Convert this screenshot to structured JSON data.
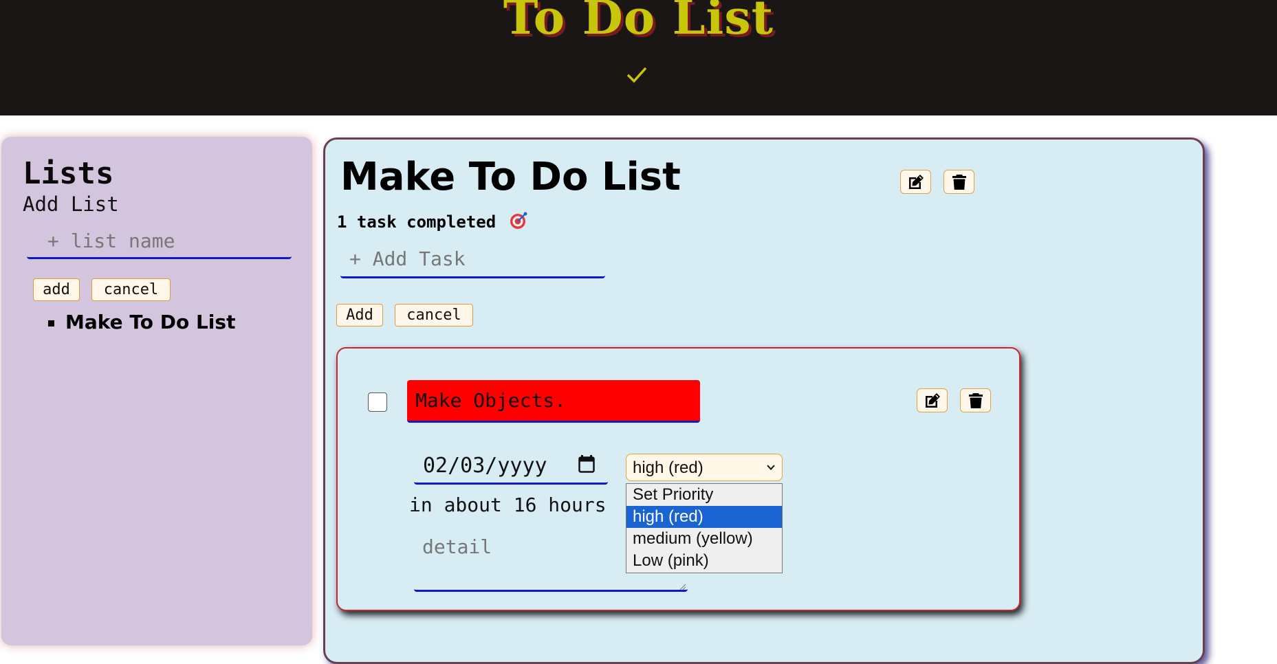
{
  "header": {
    "title": "To Do List",
    "check_icon": "check-icon"
  },
  "sidebar": {
    "title": "Lists",
    "add_list_label": "Add List",
    "list_name_placeholder": "+ list name",
    "add_label": "add",
    "cancel_label": "cancel",
    "lists": [
      {
        "name": "Make To Do List"
      }
    ]
  },
  "main": {
    "list_title": "Make To Do List",
    "edit_icon": "edit-icon",
    "delete_icon": "trash-icon",
    "tasks_completed": "1 task completed",
    "target_icon": "target-icon",
    "add_task_placeholder": "+ Add Task",
    "add_label": "Add",
    "cancel_label": "cancel",
    "task": {
      "name": "Make Objects.",
      "checked": false,
      "date": "02/03/yyyy",
      "due_text": "in about 16 hours",
      "detail_placeholder": "detail",
      "priority_selected": "high (red)",
      "priority_options": [
        "Set Priority",
        "high (red)",
        "medium (yellow)",
        "Low (pink)"
      ]
    }
  },
  "colors": {
    "header_bg": "#1b1616",
    "title_yellow": "#c7c60a",
    "title_shadow": "#7a1b1b",
    "sidebar_bg": "#d4c5de",
    "panel_bg": "#d8ecf4",
    "underline_blue": "#1018c8",
    "task_name_bg": "#ff0000",
    "option_highlight": "#1a64d2",
    "button_border": "#e39a3a"
  }
}
